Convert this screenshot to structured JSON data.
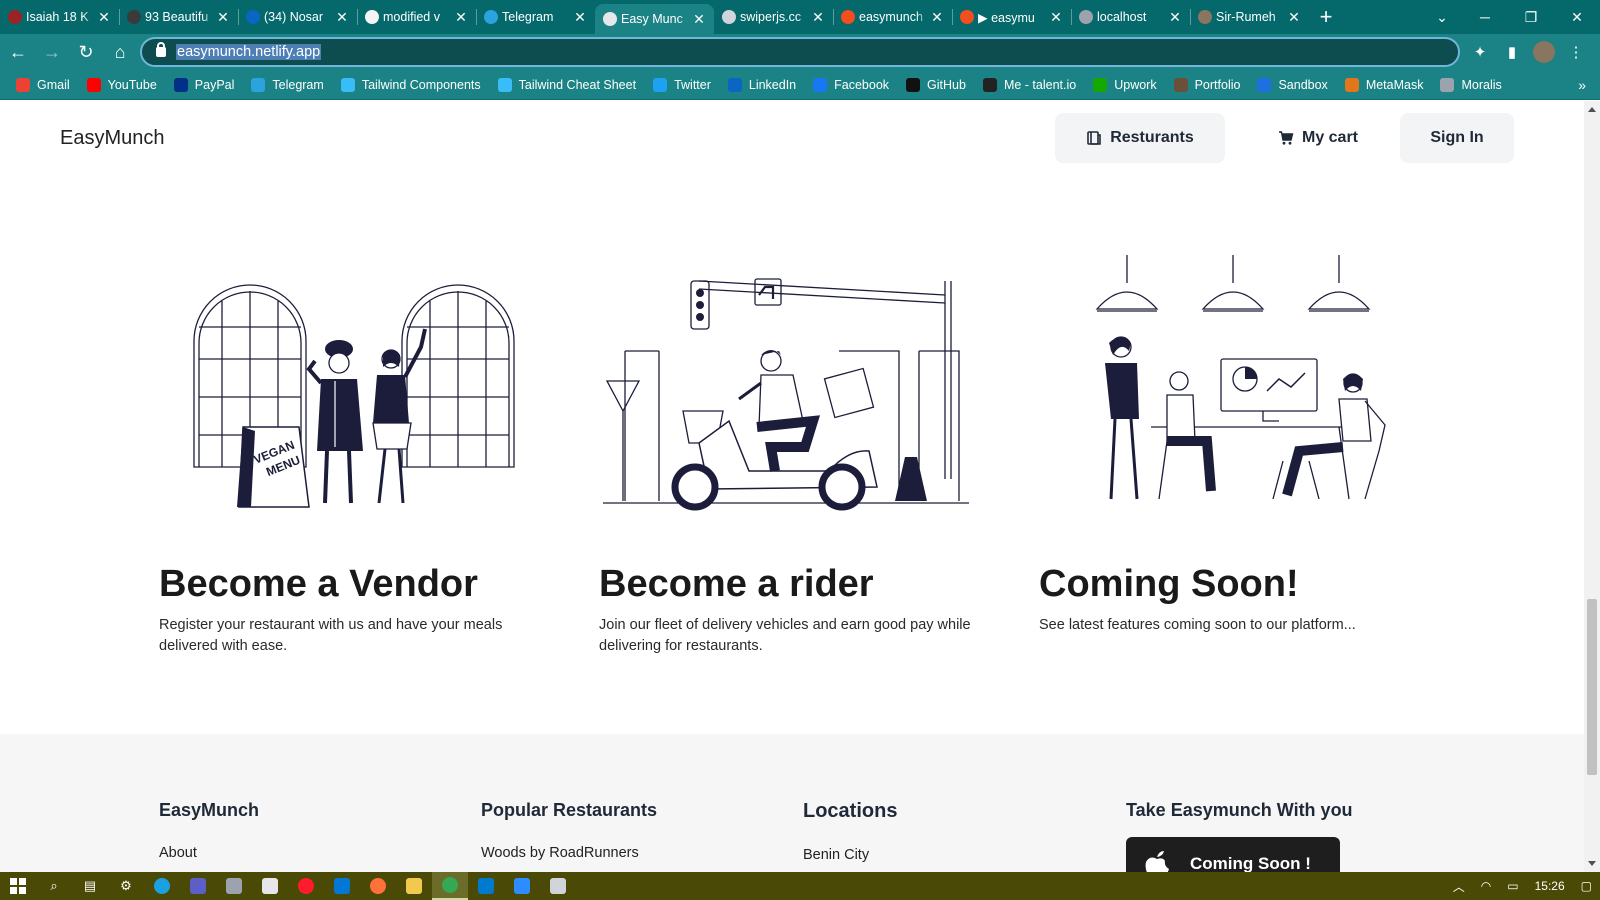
{
  "browser": {
    "tabs": [
      {
        "title": "Isaiah 18 K",
        "active": false,
        "favicon_color": "#9b2226"
      },
      {
        "title": "93 Beautifu",
        "active": false,
        "favicon_color": "#3a3a3a"
      },
      {
        "title": "(34) Nosar",
        "active": false,
        "favicon_color": "#0a66c2"
      },
      {
        "title": "modified v",
        "active": false,
        "favicon_color": "#f5f5f5"
      },
      {
        "title": "Telegram",
        "active": false,
        "favicon_color": "#2aa3df"
      },
      {
        "title": "Easy Munc",
        "active": true,
        "favicon_color": "#e5e7eb"
      },
      {
        "title": "swiperjs.cc",
        "active": false,
        "favicon_color": "#d1d5db"
      },
      {
        "title": "easymunch",
        "active": false,
        "favicon_color": "#f24e1e"
      },
      {
        "title": "▶ easymu",
        "active": false,
        "favicon_color": "#f24e1e"
      },
      {
        "title": "localhost",
        "active": false,
        "favicon_color": "#9ca3af"
      },
      {
        "title": "Sir-Rumeh",
        "active": false,
        "favicon_color": "#8a7660"
      }
    ],
    "new_tab": "+",
    "url": "easymunch.netlify.app",
    "bookmarks": [
      {
        "label": "Gmail",
        "color": "#ea4335"
      },
      {
        "label": "YouTube",
        "color": "#ff0000"
      },
      {
        "label": "PayPal",
        "color": "#003087"
      },
      {
        "label": "Telegram",
        "color": "#2aa3df"
      },
      {
        "label": "Tailwind Components",
        "color": "#38bdf8"
      },
      {
        "label": "Tailwind Cheat Sheet",
        "color": "#38bdf8"
      },
      {
        "label": "Twitter",
        "color": "#1da1f2"
      },
      {
        "label": "LinkedIn",
        "color": "#0a66c2"
      },
      {
        "label": "Facebook",
        "color": "#1877f2"
      },
      {
        "label": "GitHub",
        "color": "#111111"
      },
      {
        "label": "Me - talent.io",
        "color": "#222222"
      },
      {
        "label": "Upwork",
        "color": "#14a800"
      },
      {
        "label": "Portfolio",
        "color": "#6b4f3a"
      },
      {
        "label": "Sandbox",
        "color": "#1e6fe0"
      },
      {
        "label": "MetaMask",
        "color": "#e2761b"
      },
      {
        "label": "Moralis",
        "color": "#9ca3af"
      }
    ]
  },
  "site": {
    "brand": "EasyMunch",
    "nav": {
      "restaurants": "Resturants",
      "cart": "My cart",
      "signin": "Sign In"
    },
    "cards": [
      {
        "title": "Become a Vendor",
        "text": "Register your restaurant with us and have your meals delivered with ease."
      },
      {
        "title": "Become a rider",
        "text": "Join our fleet of delivery vehicles and earn good pay while delivering for restaurants."
      },
      {
        "title": "Coming Soon!",
        "text": "See latest features coming soon to our platform..."
      }
    ],
    "illustration_sign": [
      "VEGAN",
      "MENU"
    ],
    "footer": {
      "brand": "EasyMunch",
      "brand_link": "About",
      "popular_title": "Popular Restaurants",
      "popular_link": "Woods by RoadRunners",
      "locations_title": "Locations",
      "locations_link": "Benin City",
      "app_title": "Take Easymunch With you",
      "store_button": "Coming Soon !"
    }
  },
  "taskbar": {
    "time": "15:26"
  }
}
